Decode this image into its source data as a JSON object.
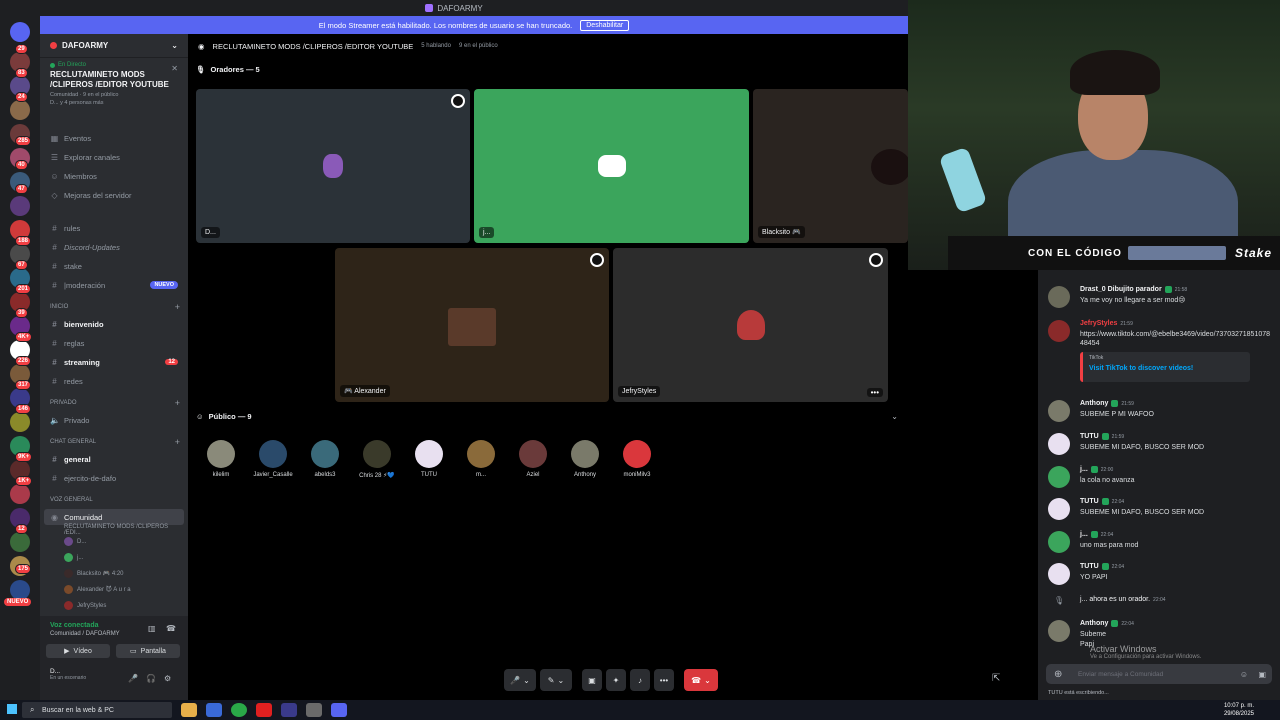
{
  "app": {
    "title": "DAFOARMY",
    "streamer_banner": "El modo Streamer está habilitado. Los nombres de usuario se han truncado.",
    "streamer_button": "Deshabilitar"
  },
  "rail": {
    "badges": [
      "29",
      "83",
      "24",
      "285",
      "40",
      "47",
      "188",
      "67",
      "201",
      "39",
      "4K+",
      "226",
      "317",
      "146",
      "9K+",
      "1K+",
      "12",
      "175"
    ],
    "new_label": "NUEVO"
  },
  "sidebar": {
    "server_name": "DAFOARMY",
    "event": {
      "status": "En Directo",
      "name": "RECLUTAMINETO MODS /CLIPEROS /EDITOR YOUTUBE",
      "meta1": "Comunidad · 9 en el público",
      "meta2": "D... y 4 personas más"
    },
    "nav": [
      "Eventos",
      "Explorar canales",
      "Miembros",
      "Mejoras del servidor"
    ],
    "channels_top": [
      {
        "label": "rules",
        "icon": "#"
      },
      {
        "label": "Discord-Updates",
        "icon": "#"
      },
      {
        "label": "stake",
        "icon": "#"
      },
      {
        "label": "|moderación",
        "icon": "#",
        "new": "NUEVO"
      }
    ],
    "cat_inicio": "INICIO",
    "inicio": [
      {
        "label": "bienvenido",
        "icon": "#"
      },
      {
        "label": "reglas",
        "icon": "#"
      },
      {
        "label": "streaming",
        "icon": "#",
        "badge": "12"
      },
      {
        "label": "redes",
        "icon": "#"
      }
    ],
    "cat_privado": "PRIVADO",
    "privado": "Privado",
    "cat_chat": "CHAT GENERAL",
    "chat": [
      "general",
      "ejercito-de-dafo"
    ],
    "cat_voz": "VOZ GENERAL",
    "voice_channel": "Comunidad",
    "voice_sub": "RECLUTAMINETO MODS /CLIPEROS /EDI...",
    "voice_users": [
      "D...",
      "j...",
      "Blacksito 🎮 4:20",
      "Alexander 😈 A u r a",
      "JefryStyles"
    ],
    "voice_status": "Voz conectada",
    "voice_location": "Comunidad / DAFOARMY",
    "video_btn": "Vídeo",
    "screen_btn": "Pantalla",
    "user_name": "D...",
    "user_status": "En un escenario"
  },
  "stage": {
    "title": "RECLUTAMINETO MODS /CLIPEROS /EDITOR YOUTUBE",
    "speaking": "5 hablando",
    "audience": "9 en el público",
    "speakers_label": "Oradores — 5",
    "tiles": [
      {
        "name": "D...",
        "color": "#2b3238"
      },
      {
        "name": "j...",
        "color": "#3ba55c"
      },
      {
        "name": "Blacksito 🎮",
        "color": "#2a2420"
      },
      {
        "name": "🎮 Alexander",
        "color": "#2e2418"
      },
      {
        "name": "JefryStyles",
        "color": "#2c2c2c"
      }
    ],
    "public_label": "Público — 9",
    "audience_members": [
      "kilelim",
      "Javier_Casalle",
      "abelds3",
      "Chris 28 ⚡💙",
      "TUTU",
      "m...",
      "Aziel",
      "Anthony",
      "moniMilv3"
    ]
  },
  "stake_overlay": {
    "text": "CON EL CÓDIGO",
    "brand": "Stake"
  },
  "chat": {
    "messages": [
      {
        "user": "Drast_0 Dibujito parador",
        "time": "21:58",
        "text": "Ya me voy no llegare a ser mod😢"
      },
      {
        "user": "JefryStyles",
        "time": "21:59",
        "text": "https://www.tiktok.com/@ebelbe3469/video/7370327185107848454"
      },
      {
        "user": "Anthony",
        "time": "21:59",
        "text": "SUBEME P MI WAFOO"
      },
      {
        "user": "TUTU",
        "time": "21:59",
        "text": "SUBEME MI DAFO, BUSCO SER MOD"
      },
      {
        "user": "j...",
        "time": "22:00",
        "text": "la cola no avanza"
      },
      {
        "user": "TUTU",
        "time": "22:04",
        "text": "SUBEME MI DAFO, BUSCO SER MOD"
      },
      {
        "user": "j...",
        "time": "22:04",
        "text": "uno mas para mod"
      },
      {
        "user": "TUTU",
        "time": "22:04",
        "text": "YO PAPI"
      },
      {
        "user": "Anthony",
        "time": "22:04",
        "text": "Subeme"
      }
    ],
    "embed_provider": "TikTok",
    "embed_title": "Visit TikTok to discover videos!",
    "system_msg": "j... ahora es un orador.",
    "system_time": "22:04",
    "last_line": "Papi",
    "input_placeholder": "Enviar mensaje a Comunidad",
    "typing": "TUTU está escribiendo...",
    "watermark_title": "Activar Windows",
    "watermark_sub": "Ve a Configuración para activar Windows."
  },
  "taskbar": {
    "search_placeholder": "Buscar en la web & PC",
    "time": "10:07 p. m.",
    "date": "29/08/2025"
  }
}
